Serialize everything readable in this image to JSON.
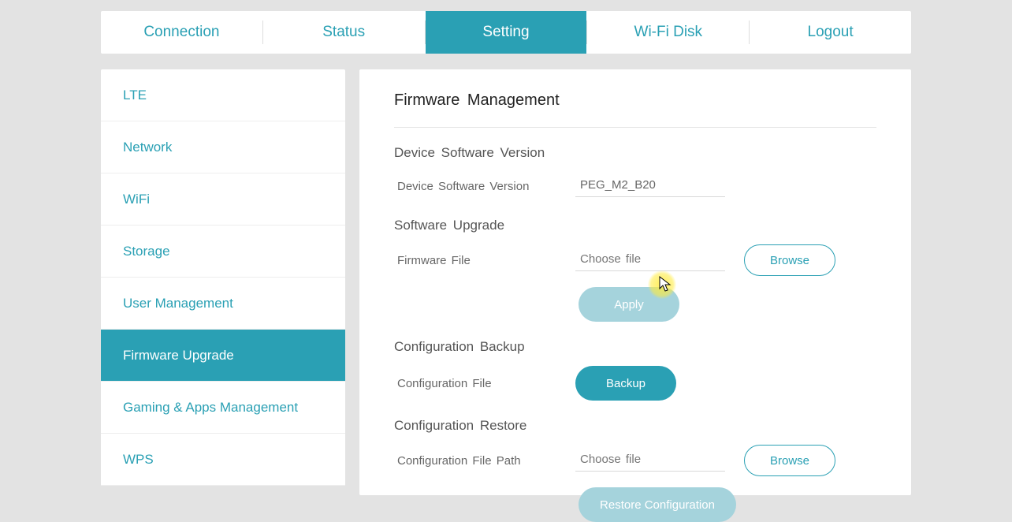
{
  "topnav": {
    "items": [
      {
        "label": "Connection",
        "active": false
      },
      {
        "label": "Status",
        "active": false
      },
      {
        "label": "Setting",
        "active": true
      },
      {
        "label": "Wi-Fi Disk",
        "active": false
      },
      {
        "label": "Logout",
        "active": false
      }
    ]
  },
  "sidebar": {
    "items": [
      {
        "label": "LTE",
        "active": false
      },
      {
        "label": "Network",
        "active": false
      },
      {
        "label": "WiFi",
        "active": false
      },
      {
        "label": "Storage",
        "active": false
      },
      {
        "label": "User Management",
        "active": false
      },
      {
        "label": "Firmware Upgrade",
        "active": true
      },
      {
        "label": "Gaming & Apps Management",
        "active": false
      },
      {
        "label": "WPS",
        "active": false
      }
    ]
  },
  "main": {
    "title": "Firmware Management",
    "device_version_section": {
      "title": "Device Software Version",
      "label": "Device Software Version",
      "value": "PEG_M2_B20"
    },
    "software_upgrade_section": {
      "title": "Software Upgrade",
      "label": "Firmware File",
      "placeholder": "Choose file",
      "browse": "Browse",
      "apply": "Apply"
    },
    "config_backup_section": {
      "title": "Configuration Backup",
      "label": "Configuration File",
      "backup": "Backup"
    },
    "config_restore_section": {
      "title": "Configuration Restore",
      "label": "Configuration File Path",
      "placeholder": "Choose file",
      "browse": "Browse",
      "restore": "Restore Configuration"
    }
  }
}
